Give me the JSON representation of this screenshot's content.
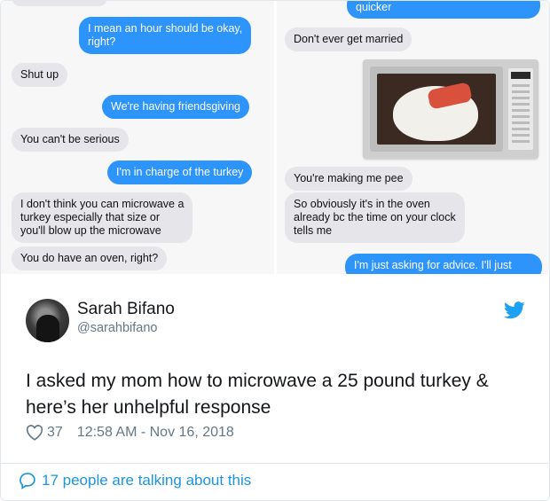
{
  "left_messages": [
    {
      "dir": "out",
      "text": "I mean an hour should be okay, right?",
      "lines": [
        "I mean an hour should be okay,",
        "right?"
      ]
    },
    {
      "dir": "in",
      "text": "Shut up"
    },
    {
      "dir": "out",
      "text": "We're having friendsgiving"
    },
    {
      "dir": "in",
      "text": "You can't be serious"
    },
    {
      "dir": "out",
      "text": "I'm in charge of the turkey"
    },
    {
      "dir": "in",
      "text": "I don't think you can microwave a turkey especially that size or you'll blow up the microwave",
      "lines": [
        "I don't think you can microwave a",
        "turkey especially that size or",
        "you'll blow up the microwave"
      ]
    },
    {
      "dir": "in",
      "text": "You do have an oven, right?"
    }
  ],
  "right_messages": [
    {
      "dir": "out",
      "text": "quicker"
    },
    {
      "dir": "in",
      "text": "Don't ever get married"
    },
    {
      "dir": "in",
      "text": "You're making me pee"
    },
    {
      "dir": "in",
      "text": "So obviously it's in the oven already bc the time on your clock tells me",
      "lines": [
        "So obviously it's in the oven",
        "already bc the time on your clock",
        "tells me"
      ]
    },
    {
      "dir": "out",
      "text": "I'm just asking for advice. I'll just"
    }
  ],
  "tweet": {
    "name": "Sarah Bifano",
    "handle": "@sarahbifano",
    "text": "I asked my mom how to microwave a 25 pound turkey & here’s her unhelpful response",
    "likes": "37",
    "timestamp": "12:58 AM - Nov 16, 2018",
    "footer": "17 people are talking about this"
  },
  "colors": {
    "outgoing_bubble": "#2d94fb",
    "incoming_bubble": "#e5e5ea",
    "twitter_blue": "#1b95e0",
    "meta_gray": "#657786"
  },
  "icons": [
    "twitter-bird-icon",
    "heart-icon",
    "speech-bubble-icon"
  ]
}
